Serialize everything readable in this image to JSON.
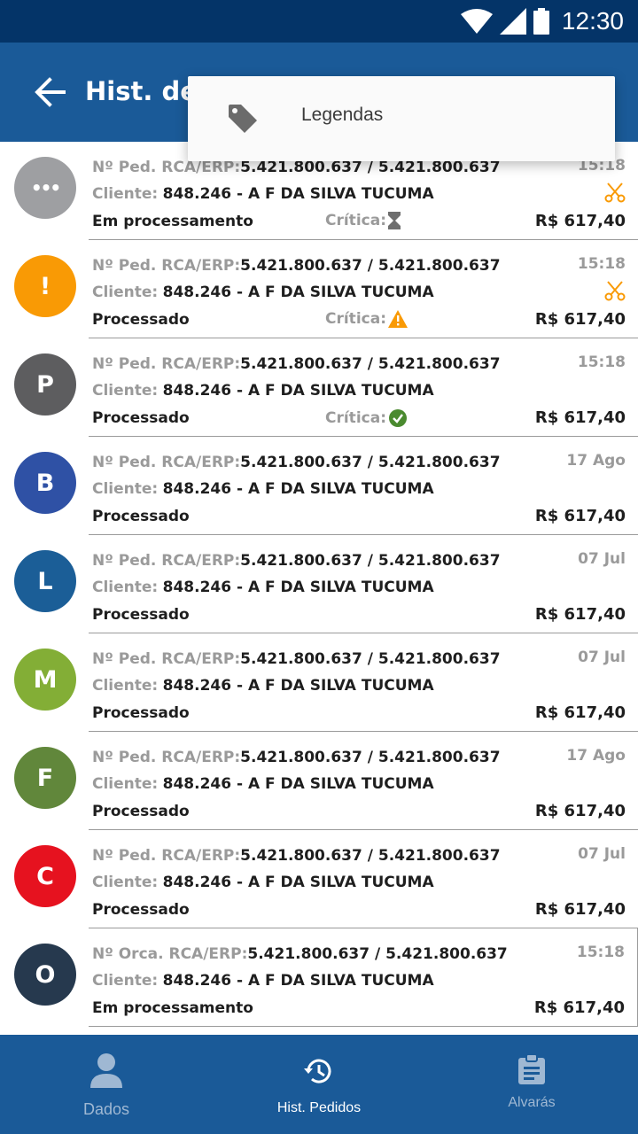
{
  "status_bar": {
    "time": "12:30"
  },
  "app_bar": {
    "title": "Hist. de"
  },
  "overflow_menu": {
    "items": [
      {
        "label": "Legendas",
        "icon": "tag-icon"
      }
    ]
  },
  "orders": [
    {
      "avatar_letter": "•••",
      "avatar_color": "#9e9fa2",
      "order_label": "Nº Ped. RCA/ERP:",
      "order_number": "5.421.800.637 / 5.421.800.637",
      "client_label": "Cliente:",
      "client": "848.246 - A F DA SILVA TUCUMA",
      "status": "Em processamento",
      "critica_label": "Crítica:",
      "critica_icon": "hourglass-icon",
      "time": "15:18",
      "cut_icon": true,
      "price": "R$ 617,40"
    },
    {
      "avatar_letter": "!",
      "avatar_color": "#f99a05",
      "order_label": "Nº Ped. RCA/ERP:",
      "order_number": "5.421.800.637 / 5.421.800.637",
      "client_label": "Cliente:",
      "client": "848.246 - A F DA SILVA TUCUMA",
      "status": "Processado",
      "critica_label": "Crítica:",
      "critica_icon": "warning-icon",
      "time": "15:18",
      "cut_icon": true,
      "price": "R$ 617,40"
    },
    {
      "avatar_letter": "P",
      "avatar_color": "#5d5d5f",
      "order_label": "Nº Ped. RCA/ERP:",
      "order_number": "5.421.800.637 / 5.421.800.637",
      "client_label": "Cliente:",
      "client": "848.246 - A F DA SILVA TUCUMA",
      "status": "Processado",
      "critica_label": "Crítica:",
      "critica_icon": "check-circle-icon",
      "time": "15:18",
      "cut_icon": false,
      "price": "R$ 617,40"
    },
    {
      "avatar_letter": "B",
      "avatar_color": "#2f51a5",
      "order_label": "Nº Ped. RCA/ERP:",
      "order_number": "5.421.800.637 / 5.421.800.637",
      "client_label": "Cliente:",
      "client": "848.246 - A F DA SILVA TUCUMA",
      "status": "Processado",
      "critica_label": "",
      "critica_icon": "",
      "time": "17 Ago",
      "cut_icon": false,
      "price": "R$ 617,40"
    },
    {
      "avatar_letter": "L",
      "avatar_color": "#1b5e97",
      "order_label": "Nº Ped. RCA/ERP:",
      "order_number": "5.421.800.637 / 5.421.800.637",
      "client_label": "Cliente:",
      "client": "848.246 - A F DA SILVA TUCUMA",
      "status": "Processado",
      "critica_label": "",
      "critica_icon": "",
      "time": "07 Jul",
      "cut_icon": false,
      "price": "R$ 617,40"
    },
    {
      "avatar_letter": "M",
      "avatar_color": "#83ae36",
      "order_label": "Nº Ped. RCA/ERP:",
      "order_number": "5.421.800.637 / 5.421.800.637",
      "client_label": "Cliente:",
      "client": "848.246 - A F DA SILVA TUCUMA",
      "status": "Processado",
      "critica_label": "",
      "critica_icon": "",
      "time": "07 Jul",
      "cut_icon": false,
      "price": "R$ 617,40"
    },
    {
      "avatar_letter": "F",
      "avatar_color": "#61873b",
      "order_label": "Nº Ped. RCA/ERP:",
      "order_number": "5.421.800.637 / 5.421.800.637",
      "client_label": "Cliente:",
      "client": "848.246 - A F DA SILVA TUCUMA",
      "status": "Processado",
      "critica_label": "",
      "critica_icon": "",
      "time": "17 Ago",
      "cut_icon": false,
      "price": "R$ 617,40"
    },
    {
      "avatar_letter": "C",
      "avatar_color": "#e6121f",
      "order_label": "Nº Ped. RCA/ERP:",
      "order_number": "5.421.800.637 / 5.421.800.637",
      "client_label": "Cliente:",
      "client": "848.246 - A F DA SILVA TUCUMA",
      "status": "Processado",
      "critica_label": "",
      "critica_icon": "",
      "time": "07 Jul",
      "cut_icon": false,
      "price": "R$ 617,40"
    },
    {
      "avatar_letter": "O",
      "avatar_color": "#26394e",
      "order_label": "Nº Orca. RCA/ERP:",
      "order_number": "5.421.800.637 / 5.421.800.637",
      "client_label": "Cliente:",
      "client": "848.246 - A F DA SILVA TUCUMA",
      "status": "Em processamento",
      "critica_label": "",
      "critica_icon": "",
      "time": "15:18",
      "cut_icon": false,
      "price": "R$ 617,40"
    }
  ],
  "bottom_nav": {
    "items": [
      {
        "label": "Dados",
        "icon": "person-icon",
        "active": false
      },
      {
        "label": "Hist. Pedidos",
        "icon": "history-icon",
        "active": true
      },
      {
        "label": "Alvarás",
        "icon": "clipboard-icon",
        "active": false
      }
    ]
  },
  "colors": {
    "status_bar": "#043468",
    "app_bar": "#1a5a98",
    "accent_orange": "#f99a05",
    "check_green": "#4a8a2f"
  }
}
